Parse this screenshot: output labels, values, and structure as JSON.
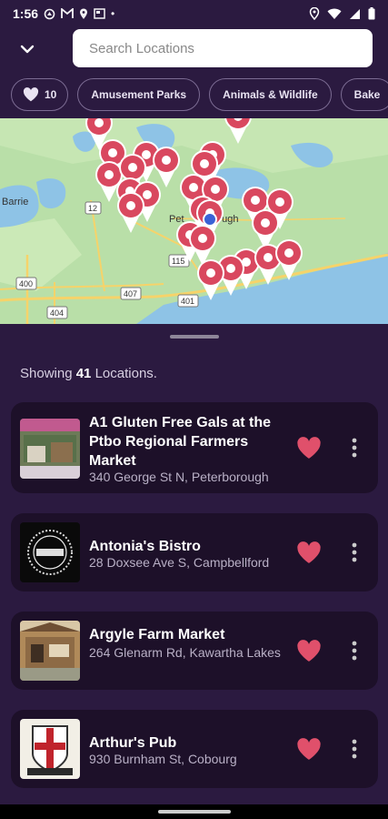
{
  "status_bar": {
    "time": "1:56",
    "dot": "•"
  },
  "search": {
    "placeholder": "Search Locations"
  },
  "chips": {
    "favorites_count": "10",
    "items": [
      "Amusement Parks",
      "Animals & Wildlife",
      "Bake"
    ]
  },
  "map": {
    "labels": [
      "Barrie",
      "Pet",
      "ough",
      "115",
      "12",
      "407",
      "401",
      "400",
      "404"
    ]
  },
  "summary": {
    "prefix": "Showing",
    "count": "41",
    "suffix": "Locations."
  },
  "locations": [
    {
      "title": "A1 Gluten Free Gals at the Ptbo Regional Farmers Market",
      "address": "340 George St N, Peterborough"
    },
    {
      "title": "Antonia's Bistro",
      "address": "28 Doxsee Ave S, Campbellford"
    },
    {
      "title": "Argyle Farm Market",
      "address": "264 Glenarm Rd, Kawartha Lakes"
    },
    {
      "title": "Arthur's Pub",
      "address": "930 Burnham St, Cobourg"
    }
  ],
  "colors": {
    "background": "#2b1a40",
    "card": "#1d1029",
    "heart": "#e0506b",
    "pin": "#d9485f",
    "water": "#8ec3e6",
    "land": "#b9dfa8",
    "road": "#f6d36a"
  }
}
